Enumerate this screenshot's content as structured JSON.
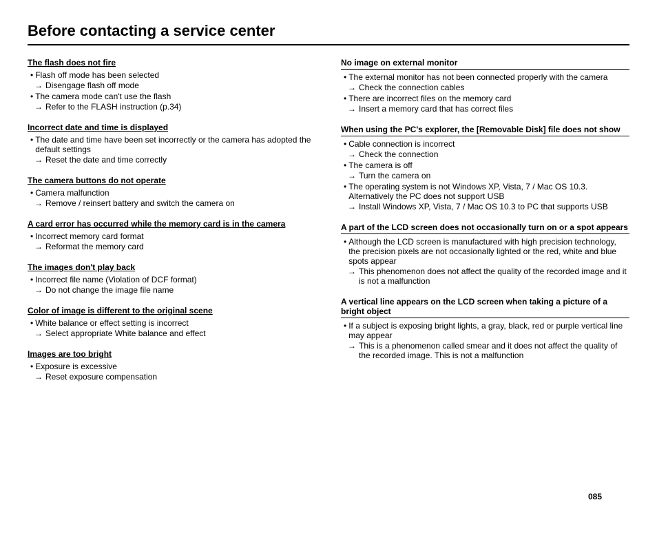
{
  "page": {
    "title": "Before contacting a service center",
    "page_number": "085"
  },
  "left_column": {
    "sections": [
      {
        "id": "flash",
        "title": "The flash does not fire",
        "title_style": "underline",
        "items": [
          {
            "type": "bullet",
            "text": "Flash off mode has been selected"
          },
          {
            "type": "arrow",
            "text": "Disengage flash off mode"
          },
          {
            "type": "bullet",
            "text": "The camera mode can't use the flash"
          },
          {
            "type": "arrow",
            "text": "Refer to the FLASH instruction (p.34)"
          }
        ]
      },
      {
        "id": "date-time",
        "title": "Incorrect date and time is displayed",
        "title_style": "underline",
        "items": [
          {
            "type": "bullet",
            "text": "The date and time have been set incorrectly or the camera has adopted the default settings"
          },
          {
            "type": "arrow",
            "text": "Reset the date and time correctly"
          }
        ]
      },
      {
        "id": "buttons",
        "title": "The camera buttons do not operate",
        "title_style": "underline",
        "items": [
          {
            "type": "bullet",
            "text": "Camera malfunction"
          },
          {
            "type": "arrow",
            "text": "Remove / reinsert battery and switch the camera on"
          }
        ]
      },
      {
        "id": "card-error",
        "title": "A card error has occurred while the memory card is in the camera",
        "title_style": "underline",
        "items": [
          {
            "type": "bullet",
            "text": "Incorrect memory card format"
          },
          {
            "type": "arrow",
            "text": "Reformat the memory card"
          }
        ]
      },
      {
        "id": "playback",
        "title": "The images don't play back",
        "title_style": "underline",
        "items": [
          {
            "type": "bullet",
            "text": "Incorrect file name (Violation of DCF format)"
          },
          {
            "type": "arrow",
            "text": "Do not change the image file name"
          }
        ]
      },
      {
        "id": "color",
        "title": "Color of image is different to the original scene",
        "title_style": "underline",
        "items": [
          {
            "type": "bullet",
            "text": "White balance or effect setting is incorrect"
          },
          {
            "type": "arrow",
            "text": "Select appropriate White balance and effect"
          }
        ]
      },
      {
        "id": "bright",
        "title": "Images are too bright",
        "title_style": "underline",
        "items": [
          {
            "type": "bullet",
            "text": "Exposure is excessive"
          },
          {
            "type": "arrow",
            "text": "Reset exposure compensation"
          }
        ]
      }
    ]
  },
  "right_column": {
    "sections": [
      {
        "id": "no-image",
        "title": "No image on external monitor",
        "title_style": "border",
        "items": [
          {
            "type": "bullet",
            "text": "The external monitor has not been connected properly with the camera"
          },
          {
            "type": "arrow",
            "text": "Check the connection cables"
          },
          {
            "type": "bullet",
            "text": "There are incorrect files on the memory card"
          },
          {
            "type": "arrow",
            "text": "Insert a memory card that has correct files"
          }
        ]
      },
      {
        "id": "removable-disk",
        "title": "When using the PC's explorer, the [Removable Disk] file does not show",
        "title_style": "border",
        "items": [
          {
            "type": "bullet",
            "text": "Cable connection is incorrect"
          },
          {
            "type": "arrow",
            "text": "Check the connection"
          },
          {
            "type": "bullet",
            "text": "The camera is off"
          },
          {
            "type": "arrow",
            "text": "Turn the camera on"
          },
          {
            "type": "bullet",
            "text": "The operating system is not Windows XP, Vista, 7 / Mac OS 10.3. Alternatively the PC does not support USB"
          },
          {
            "type": "arrow",
            "text": "Install Windows XP, Vista, 7 / Mac OS 10.3 to PC that supports USB"
          }
        ]
      },
      {
        "id": "lcd-spot",
        "title": "A part of the LCD screen does not occasionally turn on or a spot appears",
        "title_style": "border",
        "items": [
          {
            "type": "bullet",
            "text": "Although the LCD screen is manufactured with high precision technology, the precision pixels are not occasionally lighted or the red, white and blue spots appear"
          },
          {
            "type": "arrow",
            "text": "This phenomenon does not affect the quality of the recorded image and it is not a malfunction"
          }
        ]
      },
      {
        "id": "vertical-line",
        "title": "A vertical line appears on the LCD screen when taking a picture of a bright object",
        "title_style": "border",
        "items": [
          {
            "type": "bullet",
            "text": "If a subject is exposing bright lights, a gray, black, red or purple vertical line may appear"
          },
          {
            "type": "arrow",
            "text": "This is a phenomenon called smear and it does not affect the quality of the recorded image. This is not a malfunction"
          }
        ]
      }
    ]
  }
}
